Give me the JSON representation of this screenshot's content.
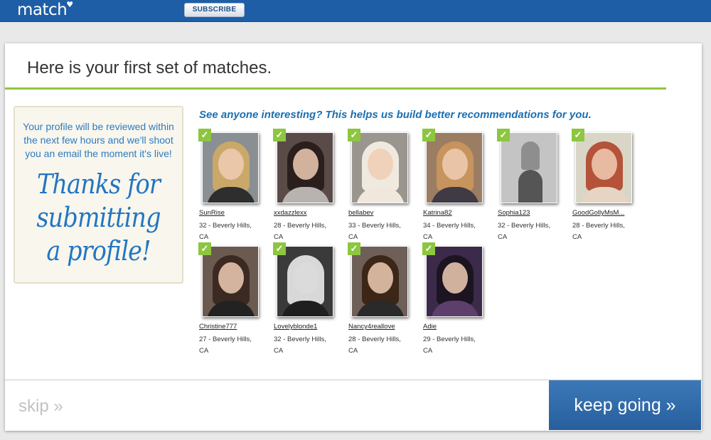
{
  "header": {
    "logo": "match",
    "subscribe_label": "SUBSCRIBE"
  },
  "main": {
    "heading": "Here is your first set of matches.",
    "notice": "Your profile will be reviewed within the next few hours and we'll shoot you an email the moment it's live!",
    "thanks_lines": [
      "Thanks for",
      "submitting",
      "a profile!"
    ],
    "prompt": "See anyone interesting? This helps us build better recommendations for you."
  },
  "matches": [
    {
      "username": "SunRise",
      "age_location": "32 - Beverly Hills,",
      "state": "CA",
      "checked": true
    },
    {
      "username": "xxdazzlexx",
      "age_location": "28 - Beverly Hills,",
      "state": "CA",
      "checked": true
    },
    {
      "username": "bellabev",
      "age_location": "33 - Beverly Hills,",
      "state": "CA",
      "checked": true
    },
    {
      "username": "Katrina82",
      "age_location": "34 - Beverly Hills,",
      "state": "CA",
      "checked": true
    },
    {
      "username": "Sophia123",
      "age_location": "32 - Beverly Hills,",
      "state": "CA",
      "checked": true
    },
    {
      "username": "GoodGollyMsM...",
      "age_location": "28 - Beverly Hills,",
      "state": "CA",
      "checked": true
    },
    {
      "username": "Christine777",
      "age_location": "27 - Beverly Hills,",
      "state": "CA",
      "checked": true
    },
    {
      "username": "Lovelyblonde1",
      "age_location": "32 - Beverly Hills,",
      "state": "CA",
      "checked": true
    },
    {
      "username": "Nancy4reallove",
      "age_location": "28 - Beverly Hills,",
      "state": "CA",
      "checked": true
    },
    {
      "username": "Adie",
      "age_location": "29 - Beverly Hills,",
      "state": "CA",
      "checked": true
    }
  ],
  "footer": {
    "skip_label": "skip »",
    "keep_going_label": "keep going »"
  },
  "colors": {
    "brand_blue": "#1d5ea6",
    "accent_green": "#8dc63f",
    "prompt_blue": "#1c6fb0"
  },
  "icons": {
    "check": "checkmark-icon",
    "logo_heart": "heart-icon"
  }
}
